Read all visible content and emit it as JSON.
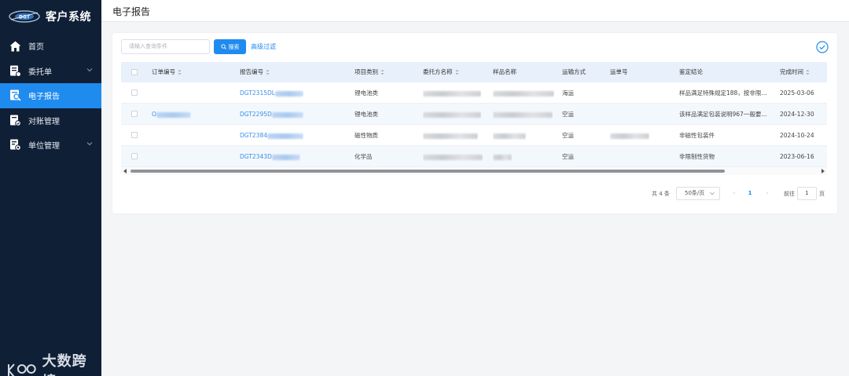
{
  "app": {
    "title": "客户系统"
  },
  "sidebar": {
    "items": [
      {
        "label": "首页",
        "icon": "home-icon",
        "active": false,
        "has_arrow": false
      },
      {
        "label": "委托单",
        "icon": "order-icon",
        "active": false,
        "has_arrow": true
      },
      {
        "label": "电子报告",
        "icon": "report-icon",
        "active": true,
        "has_arrow": false
      },
      {
        "label": "对账管理",
        "icon": "reconcile-icon",
        "active": false,
        "has_arrow": false
      },
      {
        "label": "单位管理",
        "icon": "unit-icon",
        "active": false,
        "has_arrow": true
      }
    ]
  },
  "watermark": {
    "text": "大数跨境"
  },
  "header": {
    "title": "电子报告"
  },
  "toolbar": {
    "search_placeholder": "请输入查询条件",
    "search_label": "搜索",
    "advanced_filter_label": "高级过滤"
  },
  "table": {
    "columns": [
      "订单编号",
      "报告编号",
      "项目类别",
      "委托方名称",
      "样品名称",
      "运输方式",
      "运单号",
      "鉴定结论",
      "完成时间"
    ],
    "rows": [
      {
        "order_no": "",
        "report_no": "DGT2315DL",
        "category": "锂电池类",
        "client": "",
        "sample": "",
        "transport": "海运",
        "waybill": "",
        "conclusion": "样品满足特殊规定188，按非限...",
        "date": "2025-03-06"
      },
      {
        "order_no": "O",
        "report_no": "DGT2295D",
        "category": "锂电池类",
        "client": "",
        "sample": "",
        "transport": "空运",
        "waybill": "",
        "conclusion": "该样品满足包装说明967一般要...",
        "date": "2024-12-30"
      },
      {
        "order_no": "",
        "report_no": "DGT2384",
        "category": "磁性物质",
        "client": "",
        "sample": "",
        "transport": "空运",
        "waybill": "",
        "conclusion": "非磁性包装件",
        "date": "2024-10-24"
      },
      {
        "order_no": "",
        "report_no": "DGT2343D",
        "category": "化学品",
        "client": "",
        "sample": "",
        "transport": "空运",
        "waybill": "",
        "conclusion": "非限制性货物",
        "date": "2023-06-16"
      }
    ]
  },
  "pagination": {
    "total": "共 4 条",
    "page_size": "50条/页",
    "prev": "‹",
    "current_page": "1",
    "next": "›",
    "goto_label": "前往",
    "goto_value": "1",
    "page_unit": "页"
  },
  "colors": {
    "sidebar_bg": "#0f1f35",
    "accent": "#1f8bef",
    "header_row": "#e7f0fb"
  }
}
